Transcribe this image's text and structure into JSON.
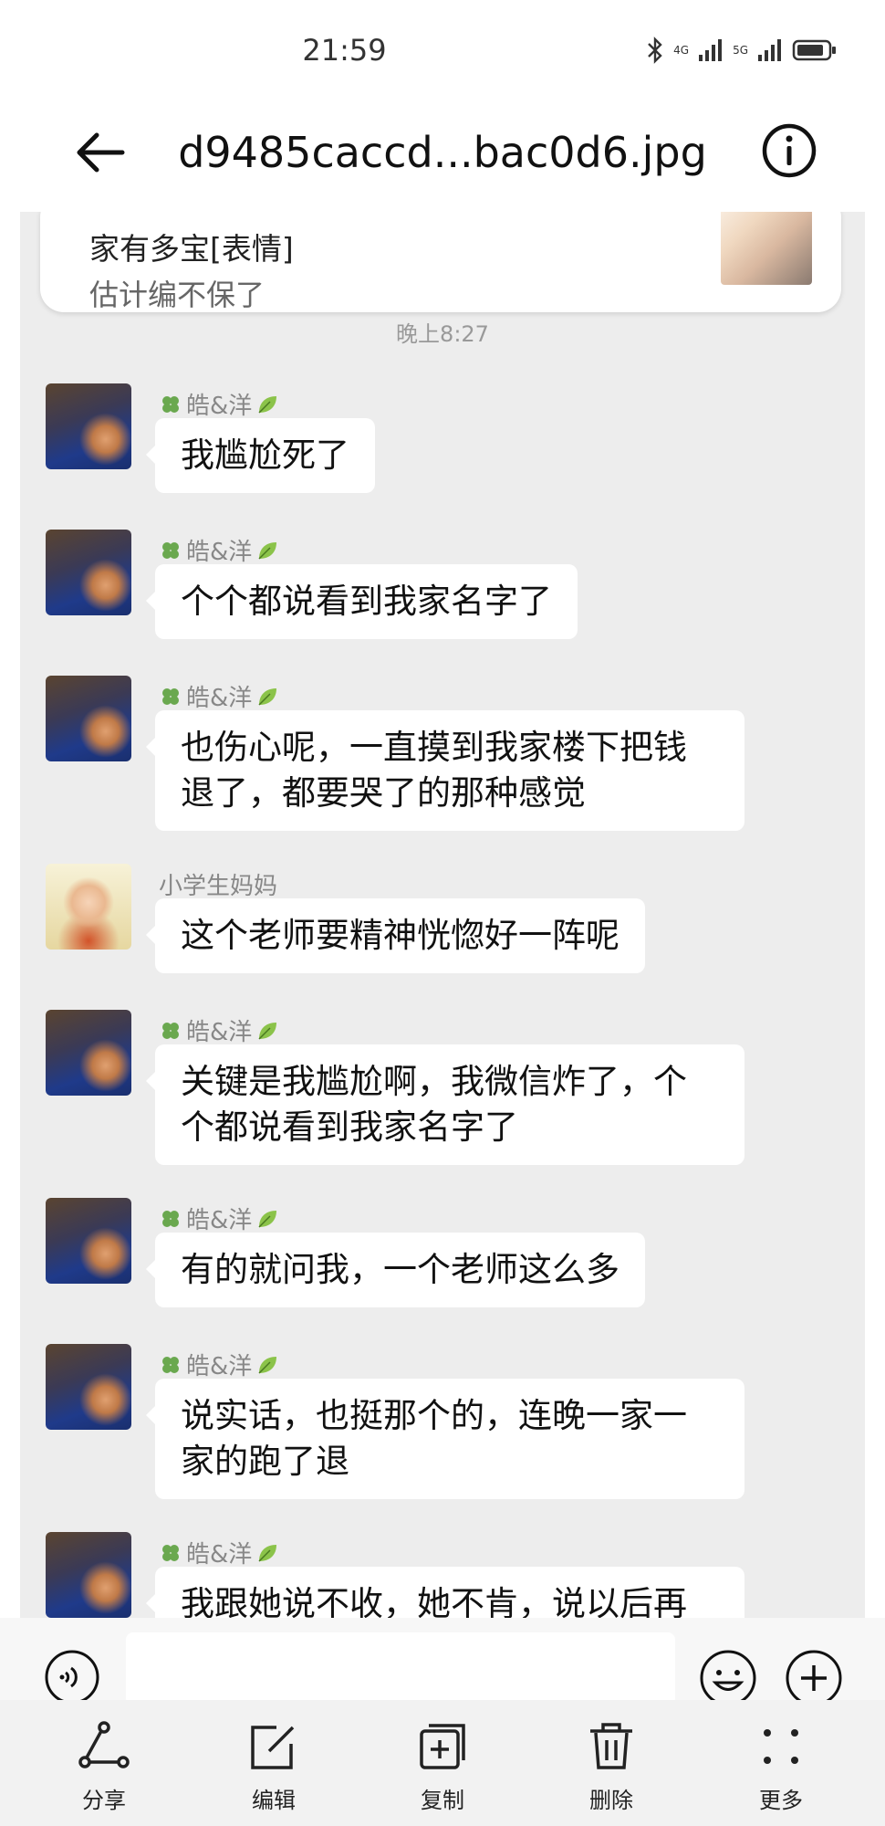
{
  "status_bar": {
    "time": "21:59",
    "network1": "4G",
    "network2": "5G"
  },
  "header": {
    "title": "d9485caccd...bac0d6.jpg"
  },
  "top_card": {
    "line1": "家有多宝[表情]",
    "line2": "估计编不保了"
  },
  "time_separator": "晚上8:27",
  "messages": [
    {
      "sender": "皓&洋",
      "text": "我尴尬死了"
    },
    {
      "sender": "皓&洋",
      "text": "个个都说看到我家名字了"
    },
    {
      "sender": "皓&洋",
      "text": "也伤心呢，一直摸到我家楼下把钱退了，都要哭了的那种感觉"
    },
    {
      "sender": "小学生妈妈",
      "text": "这个老师要精神恍惚好一阵呢"
    },
    {
      "sender": "皓&洋",
      "text": "关键是我尴尬啊，我微信炸了，个个都说看到我家名字了"
    },
    {
      "sender": "皓&洋",
      "text": "有的就问我，一个老师这么多"
    },
    {
      "sender": "皓&洋",
      "text": "说实话，也挺那个的，连晚一家一家的跑了退"
    },
    {
      "sender": "皓&洋",
      "text": "我跟她说不收，她不肯，说以后再"
    }
  ],
  "toolbar": {
    "share": "分享",
    "edit": "编辑",
    "copy": "复制",
    "delete": "删除",
    "more": "更多"
  },
  "icons": {
    "clover": "clover-icon",
    "leaf": "leaf-icon"
  },
  "colors": {
    "chat_bg": "#ededed",
    "bubble": "#ffffff",
    "toolbar_bg": "#f2f2f2"
  }
}
